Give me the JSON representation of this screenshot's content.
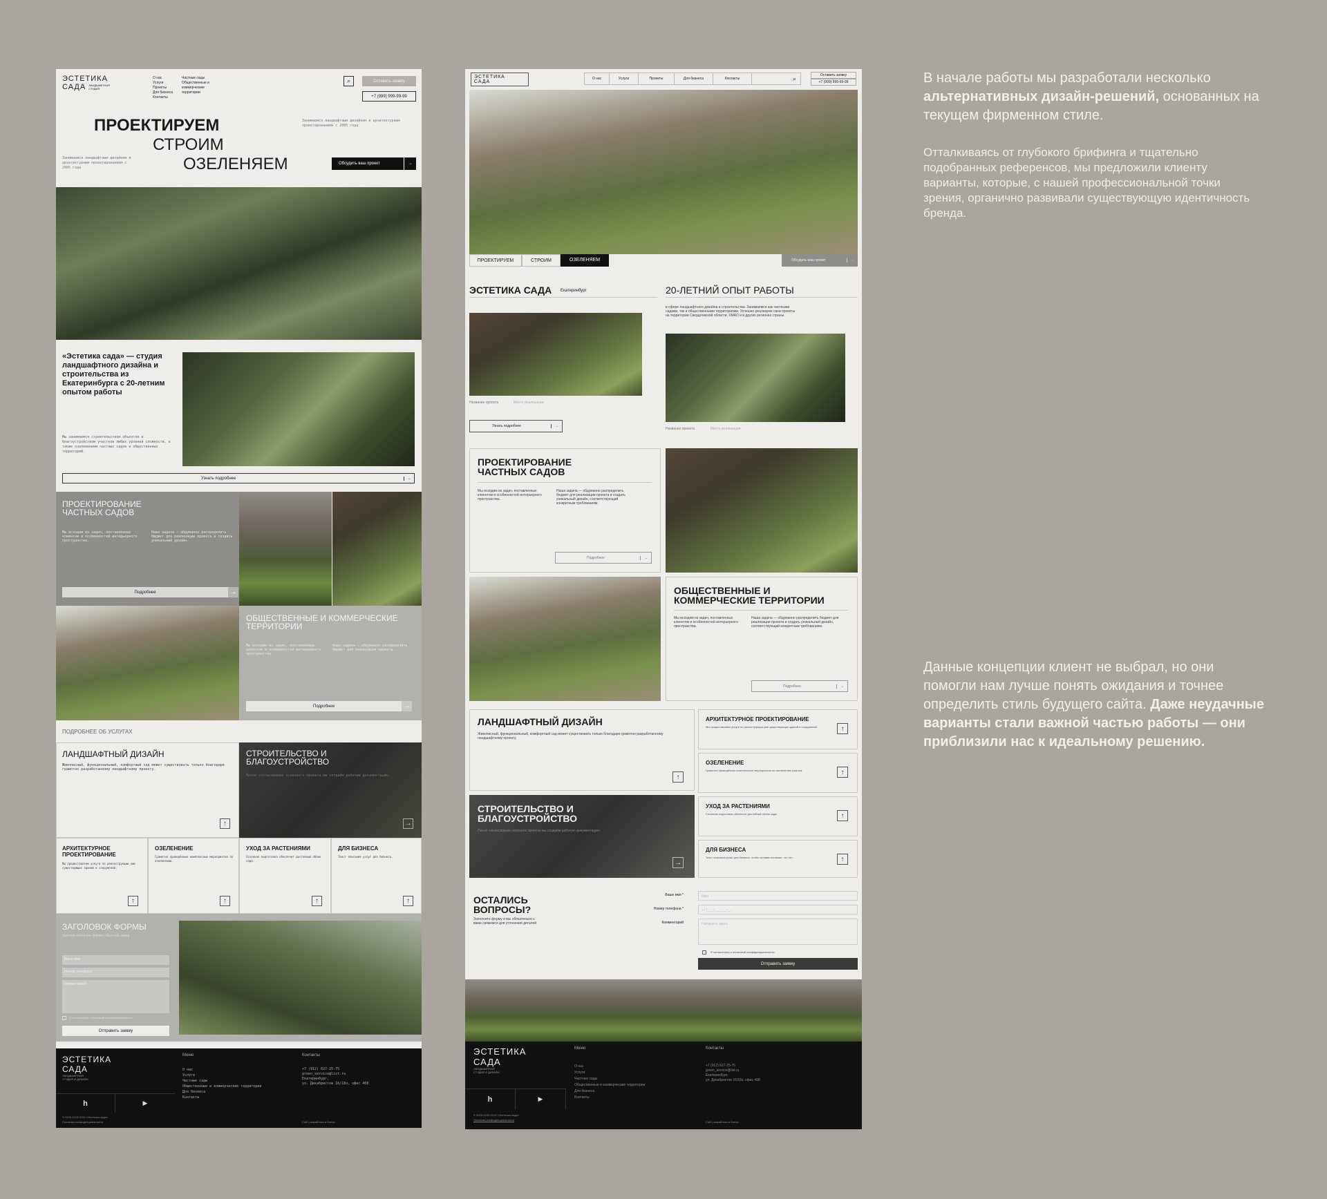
{
  "left": {
    "logo": {
      "line1": "ЭСТЕТИКА",
      "line2": "САДА",
      "tag": "ЛАНДШАФТНАЯ СТУДИЯ"
    },
    "nav1": [
      "О нас",
      "Услуги",
      "Проекты",
      "Для бизнеса",
      "Контакты"
    ],
    "nav2": [
      "Частные сады",
      "Общественные и коммерческие территории"
    ],
    "order_button": "Оставить заявку",
    "phone": "+7 (999) 999-99-99",
    "hero": {
      "line1": "ПРОЕКТИРУЕМ",
      "line2": "СТРОИМ",
      "line3": "ОЗЕЛЕНЯЕМ"
    },
    "hero_note": "Занимаемся ландшафтным дизайном и архитектурным проектированием с 2005 года",
    "hero_button": "Обсудить ваш проект",
    "about": {
      "title_a": "«Эстетика сада» — студия ландшафтного дизайна и строительства из Екатеринбурга",
      "title_b": "с 20-летним опытом работы"
    },
    "about_text": "Мы занимаемся строительством объектов и благоустройством участков любых уровней сложности, а также озеленением частных садов и общественных территорий.",
    "about_button": "Узнать подробнее",
    "private": {
      "title": "ПРОЕКТИРОВАНИЕ ЧАСТНЫХ САДОВ",
      "text1": "Мы исходим из задач, поставленных клиентом и особенностей интерьерного пространства.",
      "text2": "Наша задача — обдуманно распределить бюджет для реализации проекта и создать уникальный дизайн.",
      "button": "Подробнее"
    },
    "public": {
      "title": "ОБЩЕСТВЕННЫЕ И КОММЕРЧЕСКИЕ ТЕРРИТОРИИ",
      "text1": "Мы исходим из задач, поставленных клиентом и особенностей интерьерного пространства.",
      "text2": "Наша задача — обдуманно распределить бюджет для реализации проекта.",
      "button": "Подробнее"
    },
    "services_label": "ПОДРОБНЕЕ ОБ УСЛУГАХ",
    "landscape": {
      "title": "ЛАНДШАФТНЫЙ ДИЗАЙН",
      "text": "Живописный, функциональный, комфортный сад может существовать только благодаря грамотно разработанному ландшафтному проекту."
    },
    "building": {
      "title": "СТРОИТЕЛЬСТВО И БЛАГОУСТРОЙСТВО",
      "text": "После согласования эскизного проекта мы создаём рабочую документацию."
    },
    "cards": [
      {
        "title": "АРХИТЕКТУРНОЕ ПРОЕКТИРОВАНИЕ",
        "text": "Мы предоставляем услуги по реконструкции уже существующих зданий и сооружений."
      },
      {
        "title": "ОЗЕЛЕНЕНИЕ",
        "text": "Грамотно проведённые комплексные мероприятия по озеленению."
      },
      {
        "title": "УХОД ЗА РАСТЕНИЯМИ",
        "text": "Сезонная подготовка обеспечит достойный облик сада."
      },
      {
        "title": "ДЛЯ БИЗНЕСА",
        "text": "Текст описания услуг для бизнеса."
      }
    ],
    "form": {
      "title": "ЗАГОЛОВОК ФОРМЫ",
      "subtitle": "Краткое описание формы обратной связи",
      "name": "Ваше имя",
      "phone": "Номер телефона",
      "comment": "Комментарий",
      "consent": "Я согласен(на) с политикой конфиденциальности",
      "submit": "Отправить заявку"
    },
    "footer": {
      "logo1": "ЭСТЕТИКА",
      "logo2": "САДА",
      "tag": "ЛАНДШАФТНАЯ СТУДИЯ И ДИЗАЙН",
      "menu_label": "Меню",
      "menu": [
        "О нас",
        "Услуги",
        "Частные сады",
        "Общественные и коммерческие территории",
        "Для бизнеса",
        "Контакты"
      ],
      "contacts_label": "Контакты",
      "contacts": [
        "+7 (912) 627-25-75",
        "green_service@list.ru",
        "Екатеринбург,",
        "ул. Декабристов 16/18з, офис 408"
      ],
      "credit": "Сайт разработан в Sauda",
      "copyright": "© 2005-2023 ООО «Эстетика сада»",
      "policy": "Политика конфиденциальности",
      "icon1": "houzz-icon",
      "icon2": "youtube-icon"
    }
  },
  "mid": {
    "logo": {
      "line1": "ЭСТЕТИКА",
      "line2": "САДА"
    },
    "nav": [
      "О нас",
      "Услуги",
      "Проекты",
      "Для бизнеса",
      "Контакты"
    ],
    "order_button": "Оставить заявку",
    "phone": "+7 (999) 999-99-99",
    "tabs": [
      "ПРОЕКТИРУЕМ",
      "СТРОИМ",
      "ОЗЕЛЕНЯЕМ"
    ],
    "discuss_button": "Обсудить ваш проект",
    "brand": "ЭСТЕТИКА САДА",
    "city": "Екатеринбург",
    "experience": "20-ЛЕТНИЙ ОПЫТ РАБОТЫ",
    "experience_text": "в сфере ландшафтного дизайна и строительства. Занимаемся как частными садами, так и общественными территориями. Успешно реализуем свои проекты на территории Свердловской области, ХМАО и в других регионах страны.",
    "project_name": "Название проекта",
    "project_place": "Место реализации",
    "more_button": "Узнать подробнее",
    "private": {
      "title": "ПРОЕКТИРОВАНИЕ ЧАСТНЫХ САДОВ",
      "text1": "Мы исходим из задач, поставленных клиентом и особенностей интерьерного пространства.",
      "text2": "Наша задача — обдуманно распределить бюджет для реализации проекта и создать уникальный дизайн, соответствующий конкретным требованиям.",
      "button": "Подробнее"
    },
    "public": {
      "title": "ОБЩЕСТВЕННЫЕ И КОММЕРЧЕСКИЕ ТЕРРИТОРИИ",
      "text1": "Мы исходим из задач, поставленных клиентом и особенностей интерьерного пространства.",
      "text2": "Наша задача — обдуманно распределить бюджет для реализации проекта и создать уникальный дизайн, соответствующий конкретным требованиям.",
      "button": "Подробнее"
    },
    "landscape": {
      "title": "ЛАНДШАФТНЫЙ ДИЗАЙН",
      "text": "Живописный, функциональный, комфортный сад может существовать только благодаря грамотно разработанному ландшафтному проекту."
    },
    "building": {
      "title": "СТРОИТЕЛЬСТВО И БЛАГОУСТРОЙСТВО",
      "text": "После согласования эскизного проекта мы создаём рабочую документацию."
    },
    "services": [
      {
        "title": "АРХИТЕКТУРНОЕ ПРОЕКТИРОВАНИЕ",
        "text": "Мы предоставляем услуги по реконструкции уже существующих зданий и сооружений."
      },
      {
        "title": "ОЗЕЛЕНЕНИЕ",
        "text": "Грамотно проведённые комплексные мероприятия по озеленению участка."
      },
      {
        "title": "УХОД ЗА РАСТЕНИЯМИ",
        "text": "Сезонная подготовка обеспечит достойный облик сада."
      },
      {
        "title": "ДЛЯ БИЗНЕСА",
        "text": "Текст описания услуг для бизнеса, чтобы человек понимал, что это."
      }
    ],
    "questions": {
      "title": "ОСТАЛИСЬ ВОПРОСЫ?",
      "text": "Заполните форму и мы обязательно с вами свяжемся для уточнения деталей",
      "name_label": "Ваше имя *",
      "name_ph": "Имя",
      "phone_label": "Номер телефона *",
      "phone_ph": "+7 (___) ___-__-__",
      "comment_label": "Комментарий",
      "comment_ph": "Напишите здесь",
      "consent": "Я согласен(на) с политикой конфиденциальности",
      "submit": "Отправить заявку"
    },
    "footer": {
      "logo1": "ЭСТЕТИКА",
      "logo2": "САДА",
      "tag": "ЛАНДШАФТНАЯ СТУДИЯ И ДИЗАЙН",
      "menu_label": "Меню",
      "menu": [
        "О нас",
        "Услуги",
        "Частные сады",
        "Общественные и коммерческие территории",
        "Для бизнеса",
        "Контакты"
      ],
      "contacts_label": "Контакты",
      "contacts": [
        "+7 (912) 627-25-75",
        "green_service@list.ru",
        "Екатеринбург,",
        "ул. Декабристов 16/18з, офис 408"
      ],
      "credit": "Сайт разработан в Sauda",
      "copyright": "© 2005-2023 ООО «Эстетика сада»",
      "policy": "Политика конфиденциальности"
    }
  },
  "right": {
    "p1_a": "В начале работы мы разработали несколько ",
    "p1_b": "альтернативных дизайн-решений,",
    "p1_c": " основанных на текущем фирменном стиле.",
    "p2": "Отталкиваясь от глубокого брифинга и тщательно подобранных референсов, мы предложили клиенту варианты, которые, с нашей профессиональной точки зрения, органично развивали существующую идентичность бренда.",
    "p3_a": "Данные концепции клиент не выбрал, но они помогли нам лучше понять ожидания и точнее определить стиль будущего сайта.",
    "p3_b": "Даже неудачные варианты стали важной частью работы — они приблизили нас к идеальному решению."
  }
}
